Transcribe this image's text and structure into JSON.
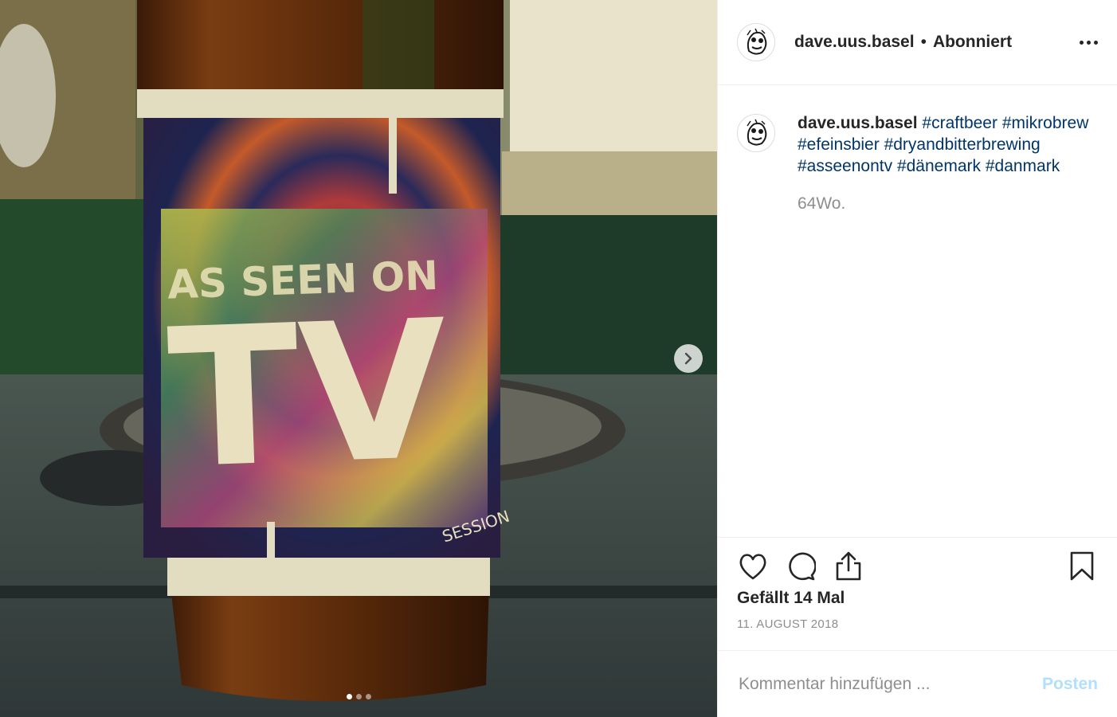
{
  "post": {
    "image_alt": "",
    "carousel": {
      "count": 3,
      "active_index": 0
    },
    "label": {
      "line1": "AS SEEN ON",
      "line2": "TV",
      "line3": "SESSION"
    }
  },
  "header": {
    "username": "dave.uus.basel",
    "separator": "•",
    "follow_status": "Abonniert"
  },
  "caption": {
    "username": "dave.uus.basel",
    "hashtags": [
      "#craftbeer",
      "#mikrobrew",
      "#efeinsbier",
      "#dryandbitterbrewing",
      "#asseenontv",
      "#dänemark",
      "#danmark"
    ],
    "time": "64Wo."
  },
  "actions": {
    "icons": [
      "heart-icon",
      "comment-icon",
      "share-icon",
      "bookmark-icon"
    ],
    "likes": "Gefällt 14 Mal",
    "date": "11. AUGUST 2018"
  },
  "comment_bar": {
    "placeholder": "Kommentar hinzufügen ...",
    "post_label": "Posten",
    "post_color": "#b2dffc"
  },
  "colors": {
    "hashtag": "#003569",
    "secondary_text": "#8e8e8e",
    "border": "#efefef"
  }
}
